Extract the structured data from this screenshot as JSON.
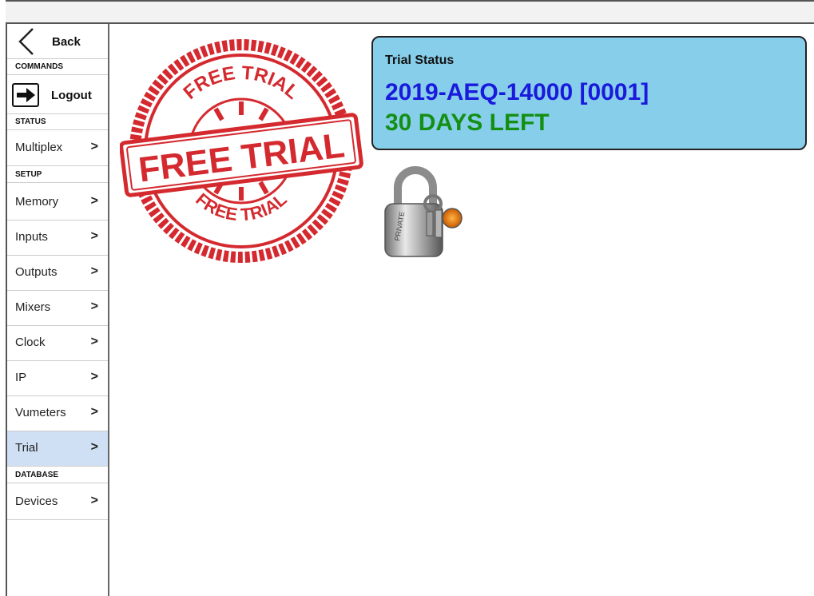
{
  "sidebar": {
    "back_label": "Back",
    "sections": {
      "commands": "COMMANDS",
      "status": "STATUS",
      "setup": "SETUP",
      "database": "DATABASE"
    },
    "logout_label": "Logout",
    "status_items": [
      {
        "label": "Multiplex"
      }
    ],
    "setup_items": [
      {
        "label": "Memory"
      },
      {
        "label": "Inputs"
      },
      {
        "label": "Outputs"
      },
      {
        "label": "Mixers"
      },
      {
        "label": "Clock"
      },
      {
        "label": "IP"
      },
      {
        "label": "Vumeters"
      },
      {
        "label": "Trial",
        "active": true
      }
    ],
    "database_items": [
      {
        "label": "Devices"
      }
    ],
    "chevron": ">"
  },
  "stamp": {
    "top_text": "FREE TRIAL",
    "center_text": "FREE TRIAL",
    "bottom_text": "FREE TRIAL",
    "color": "#d42a2f"
  },
  "trial_status": {
    "title": "Trial Status",
    "serial": "2019-AEQ-14000 [0001]",
    "days_left": "30 DAYS LEFT",
    "colors": {
      "box": "#87ceeb",
      "serial": "#1a1adc",
      "days": "#148f14"
    }
  },
  "lock_image": {
    "icon": "padlock-with-keys-icon",
    "engraving": "PRIVATE"
  }
}
